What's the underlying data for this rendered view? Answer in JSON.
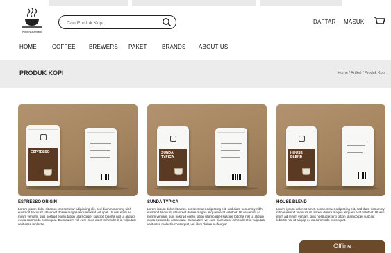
{
  "header": {
    "logo_text": "Kopi Nusantara",
    "search": {
      "placeholder": "Cari Produk Kopi"
    },
    "links": {
      "register": "DAFTAR",
      "login": "MASUK"
    },
    "cart_icon": "cart-icon",
    "search_icon": "search-icon"
  },
  "nav": [
    "HOME",
    "COFFEE",
    "BREWERS",
    "PAKET",
    "BRANDS",
    "ABOUT US"
  ],
  "banner": {
    "title": "PRODUK KOPI",
    "breadcrumb": "Home / Artikel / Produk Kopi"
  },
  "products": [
    {
      "name": "ESPRESSO ORIGIN",
      "pack_label": "ESPRESSO",
      "description": "Lorem ipsum dolor sit amet, consectetur adipiscing elit, sed diam nonummy nibh euismod tincidunt ut laoreet dolore magna aliquam erat volutpat. Ut wisi enim ad minim veniam, quis nostrud exerci tation ullamcorper suscipit lobortis nisl ut aliquip ex ea commodo consequat. Duis autem vel eum iriure dolor in hendrerit in vulputate velit esse molestie."
    },
    {
      "name": "SUNDA TYPICA",
      "pack_label": "SUNDA TYPICA",
      "description": "Lorem ipsum dolor sit amet, consectetuer adipiscing elit, sed diam nonummy nibh euismod tincidunt ut laoreet dolore magna aliquam erat volutpat. Ut wisi enim ad minim veniam, quis nostrud exerci tation ullamcorper suscipit lobortis nisl ut aliquip ex ea commodo consequat. Duis autem vel eum iriure dolor in hendrerit in vulputate velit esse molestie consequat, vel illum dolore eu feugiat."
    },
    {
      "name": "HOUSE BLEND",
      "pack_label": "HOUSE BLEND",
      "description": "Lorem ipsum dolor sit amet, consectetuer adipiscing elit, sed diam nonummy nibh euismod tincidunt ut laoreet dolore magna aliquam erat volutpat. Ut wisi enim ad minim veniam, quis nostrud exerci tation ullamcorper suscipit lobortis nisl ut aliquip ex ea commodo consequat."
    }
  ],
  "chat": {
    "status": "Offline"
  },
  "colors": {
    "brand": "#6b4a2c",
    "banner": "#ececec",
    "card_bg": "#a4845f"
  }
}
